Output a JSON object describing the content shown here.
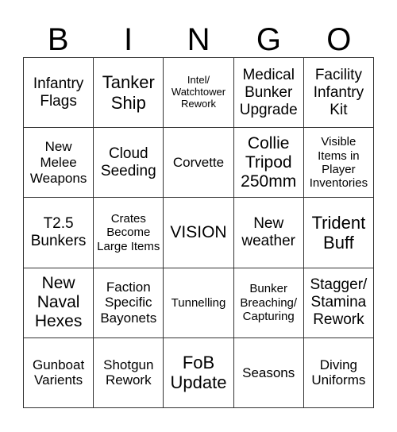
{
  "header": [
    "B",
    "I",
    "N",
    "G",
    "O"
  ],
  "cells": [
    "Infantry Flags",
    "Tanker Ship",
    "Intel/ Watchtower Rework",
    "Medical Bunker Upgrade",
    "Facility Infantry Kit",
    "New Melee Weapons",
    "Cloud Seeding",
    "Corvette",
    "Collie Tripod 250mm",
    "Visible Items in Player Inventories",
    "T2.5 Bunkers",
    "Crates Become Large Items",
    "VISION",
    "New weather",
    "Trident Buff",
    "New Naval Hexes",
    "Faction Specific Bayonets",
    "Tunnelling",
    "Bunker Breaching/ Capturing",
    "Stagger/ Stamina Rework",
    "Gunboat Varients",
    "Shotgun Rework",
    "FoB Update",
    "Seasons",
    "Diving Uniforms"
  ]
}
